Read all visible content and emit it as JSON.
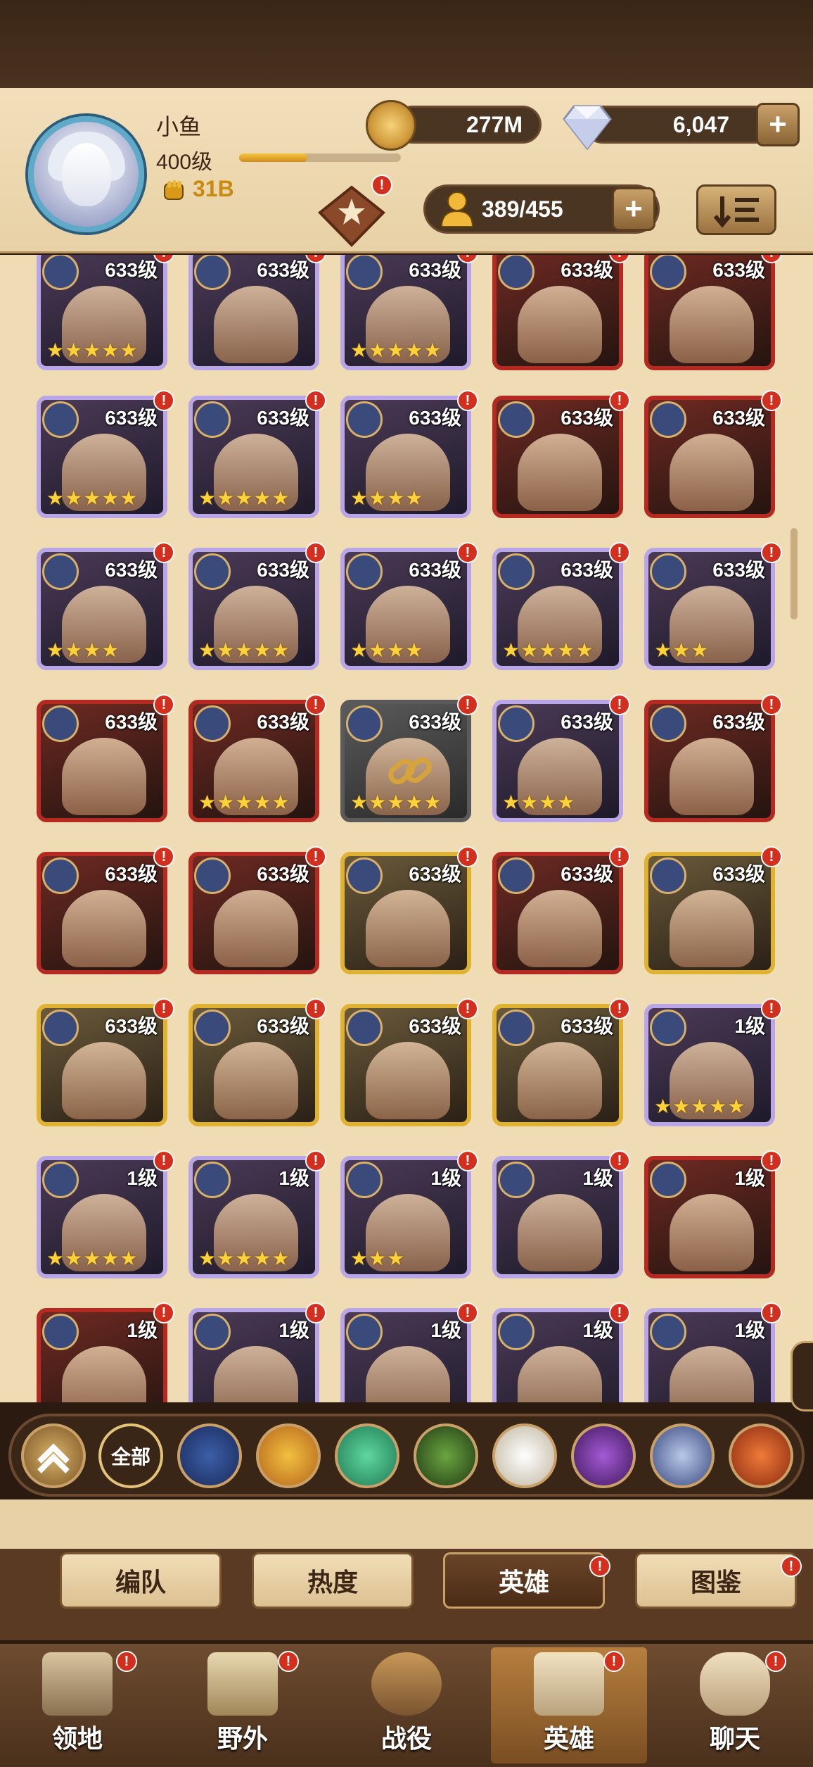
{
  "player": {
    "name": "小鱼",
    "level": "400级",
    "power": "31B",
    "xp_fraction": 0.42
  },
  "currency": {
    "gold": "277M",
    "gems": "6,047"
  },
  "heroes_count": "389/455",
  "badge_mark": "!",
  "heroes": [
    {
      "level": "633级",
      "stars": "★★★★★",
      "frame": "purple"
    },
    {
      "level": "633级",
      "stars": "",
      "frame": "purple"
    },
    {
      "level": "633级",
      "stars": "★★★★★",
      "frame": "purple"
    },
    {
      "level": "633级",
      "stars": "",
      "frame": "red"
    },
    {
      "level": "633级",
      "stars": "",
      "frame": "red"
    },
    {
      "level": "633级",
      "stars": "★★★★★",
      "frame": "purple"
    },
    {
      "level": "633级",
      "stars": "★★★★★",
      "frame": "purple"
    },
    {
      "level": "633级",
      "stars": "★★★★",
      "frame": "purple"
    },
    {
      "level": "633级",
      "stars": "",
      "frame": "red"
    },
    {
      "level": "633级",
      "stars": "",
      "frame": "red"
    },
    {
      "level": "633级",
      "stars": "★★★★",
      "frame": "purple"
    },
    {
      "level": "633级",
      "stars": "★★★★★",
      "frame": "purple"
    },
    {
      "level": "633级",
      "stars": "★★★★",
      "frame": "purple"
    },
    {
      "level": "633级",
      "stars": "★★★★★",
      "frame": "purple"
    },
    {
      "level": "633级",
      "stars": "★★★",
      "frame": "purple"
    },
    {
      "level": "633级",
      "stars": "",
      "frame": "red"
    },
    {
      "level": "633级",
      "stars": "★★★★★",
      "frame": "red"
    },
    {
      "level": "633级",
      "stars": "★★★★★",
      "frame": "locked"
    },
    {
      "level": "633级",
      "stars": "★★★★",
      "frame": "purple"
    },
    {
      "level": "633级",
      "stars": "",
      "frame": "red"
    },
    {
      "level": "633级",
      "stars": "",
      "frame": "red"
    },
    {
      "level": "633级",
      "stars": "",
      "frame": "red"
    },
    {
      "level": "633级",
      "stars": "",
      "frame": "gold"
    },
    {
      "level": "633级",
      "stars": "",
      "frame": "red"
    },
    {
      "level": "633级",
      "stars": "",
      "frame": "gold"
    },
    {
      "level": "633级",
      "stars": "",
      "frame": "gold"
    },
    {
      "level": "633级",
      "stars": "",
      "frame": "gold"
    },
    {
      "level": "633级",
      "stars": "",
      "frame": "gold"
    },
    {
      "level": "633级",
      "stars": "",
      "frame": "gold"
    },
    {
      "level": "1级",
      "stars": "★★★★★",
      "frame": "purple"
    },
    {
      "level": "1级",
      "stars": "★★★★★",
      "frame": "purple"
    },
    {
      "level": "1级",
      "stars": "★★★★★",
      "frame": "purple"
    },
    {
      "level": "1级",
      "stars": "★★★",
      "frame": "purple"
    },
    {
      "level": "1级",
      "stars": "",
      "frame": "purple"
    },
    {
      "level": "1级",
      "stars": "",
      "frame": "red"
    },
    {
      "level": "1级",
      "stars": "",
      "frame": "red"
    },
    {
      "level": "1级",
      "stars": "",
      "frame": "purple"
    },
    {
      "level": "1级",
      "stars": "",
      "frame": "purple"
    },
    {
      "level": "1级",
      "stars": "",
      "frame": "purple"
    },
    {
      "level": "1级",
      "stars": "",
      "frame": "purple"
    }
  ],
  "filters": {
    "all_label": "全部"
  },
  "tabs": [
    "编队",
    "热度",
    "英雄",
    "图鉴"
  ],
  "nav": [
    "领地",
    "野外",
    "战役",
    "英雄",
    "聊天"
  ],
  "colors": {
    "accent": "#e0b232",
    "badge": "#d32f1f",
    "panel": "#efdcb4"
  }
}
